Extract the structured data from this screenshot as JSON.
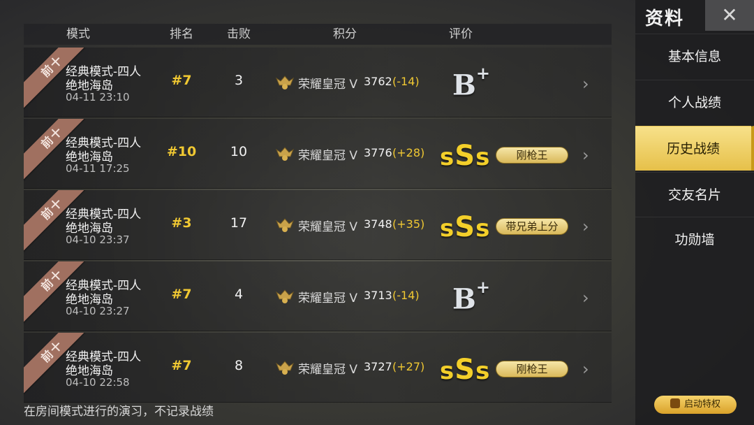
{
  "header": {
    "mode": "模式",
    "rank": "排名",
    "kills": "击败",
    "score": "积分",
    "rating": "评价"
  },
  "rows": [
    {
      "ribbon": "前十",
      "mode_line1": "经典模式-四人",
      "mode_line2": "绝地海岛",
      "date": "04-11 23:10",
      "rank": "#7",
      "kills": "3",
      "tier": "荣耀皇冠 V",
      "score": "3762",
      "delta": "(-14)",
      "grade": "B+",
      "badge": ""
    },
    {
      "ribbon": "前十",
      "mode_line1": "经典模式-四人",
      "mode_line2": "绝地海岛",
      "date": "04-11 17:25",
      "rank": "#10",
      "kills": "10",
      "tier": "荣耀皇冠 V",
      "score": "3776",
      "delta": "(+28)",
      "grade": "SSS",
      "badge": "刚枪王"
    },
    {
      "ribbon": "前十",
      "mode_line1": "经典模式-四人",
      "mode_line2": "绝地海岛",
      "date": "04-10 23:37",
      "rank": "#3",
      "kills": "17",
      "tier": "荣耀皇冠 V",
      "score": "3748",
      "delta": "(+35)",
      "grade": "SSS",
      "badge": "带兄弟上分"
    },
    {
      "ribbon": "前十",
      "mode_line1": "经典模式-四人",
      "mode_line2": "绝地海岛",
      "date": "04-10 23:27",
      "rank": "#7",
      "kills": "4",
      "tier": "荣耀皇冠 V",
      "score": "3713",
      "delta": "(-14)",
      "grade": "B+",
      "badge": ""
    },
    {
      "ribbon": "前十",
      "mode_line1": "经典模式-四人",
      "mode_line2": "绝地海岛",
      "date": "04-10 22:58",
      "rank": "#7",
      "kills": "8",
      "tier": "荣耀皇冠 V",
      "score": "3727",
      "delta": "(+27)",
      "grade": "SSS",
      "badge": "刚枪王"
    }
  ],
  "footnote": "在房间模式进行的演习，不记录战绩",
  "sidebar": {
    "title": "资料",
    "close_icon": "✕",
    "items": [
      {
        "label": "基本信息",
        "active": false
      },
      {
        "label": "个人战绩",
        "active": false
      },
      {
        "label": "历史战绩",
        "active": true
      },
      {
        "label": "交友名片",
        "active": false
      },
      {
        "label": "功勋墙",
        "active": false
      }
    ],
    "privilege_label": "启动特权"
  },
  "colors": {
    "accent_gold": "#f0c832",
    "active_tab": "#f7e18a",
    "ribbon": "#a07060"
  }
}
